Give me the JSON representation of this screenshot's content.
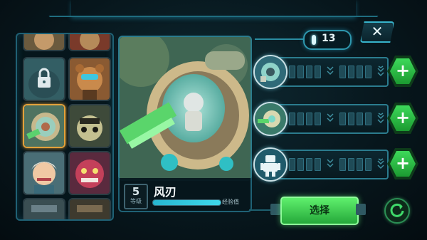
{
  "counter": {
    "value": "13"
  },
  "close": {
    "label": "✕"
  },
  "hero": {
    "level": "5",
    "level_label": "等级",
    "name": "风刃",
    "exp_label": "经验值",
    "exp_percent": 100
  },
  "select": {
    "label": "选择"
  },
  "skills": [
    {
      "icon": "mech-orb-icon",
      "plus": "+"
    },
    {
      "icon": "drill-mech-icon",
      "plus": "+"
    },
    {
      "icon": "robot-icon",
      "plus": "+"
    }
  ],
  "colors": {
    "accent": "#2b7c8e",
    "green": "#3dd95a",
    "gold": "#e3a13a"
  }
}
